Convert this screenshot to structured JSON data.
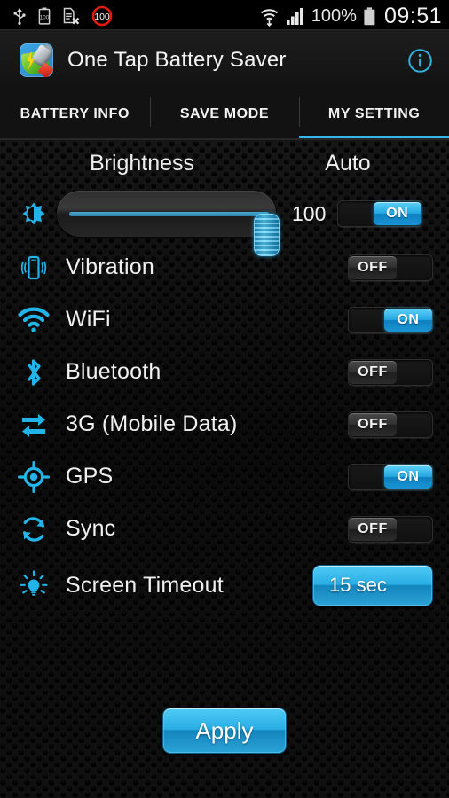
{
  "statusbar": {
    "icons_left": [
      "usb-icon",
      "battery-100-icon",
      "sd-card-removed-icon",
      "red-100-badge"
    ],
    "red_badge_text": "100",
    "small_battery_text": "100",
    "wifi_icon": "wifi-signal-icon",
    "cellular_icon": "cellular-signal-icon",
    "battery_percent": "100%",
    "battery_icon": "battery-full-icon",
    "clock": "09:51"
  },
  "actionbar": {
    "app_icon": "app-logo-icon",
    "title": "One Tap Battery Saver",
    "info_icon": "info-circle-icon"
  },
  "tabs": [
    {
      "label": "BATTERY INFO",
      "active": false
    },
    {
      "label": "SAVE MODE",
      "active": false
    },
    {
      "label": "MY SETTING",
      "active": true
    }
  ],
  "colors": {
    "accent": "#33b5e5",
    "accent_light": "#5fd0f8",
    "background": "#0b0b0b",
    "text": "#f0f0f0"
  },
  "content": {
    "headers": {
      "brightness": "Brightness",
      "auto": "Auto"
    },
    "brightness": {
      "icon": "brightness-icon",
      "value": "100",
      "percent": 100,
      "auto_toggle": "ON"
    },
    "rows": [
      {
        "icon": "vibration-icon",
        "label": "Vibration",
        "toggle": "OFF"
      },
      {
        "icon": "wifi-icon",
        "label": "WiFi",
        "toggle": "ON"
      },
      {
        "icon": "bluetooth-icon",
        "label": "Bluetooth",
        "toggle": "OFF"
      },
      {
        "icon": "mobile-data-icon",
        "label": "3G (Mobile Data)",
        "toggle": "OFF"
      },
      {
        "icon": "gps-icon",
        "label": "GPS",
        "toggle": "ON"
      },
      {
        "icon": "sync-icon",
        "label": "Sync",
        "toggle": "OFF"
      }
    ],
    "screen_timeout": {
      "icon": "lightbulb-icon",
      "label": "Screen Timeout",
      "value": "15 sec"
    },
    "apply_label": "Apply"
  }
}
